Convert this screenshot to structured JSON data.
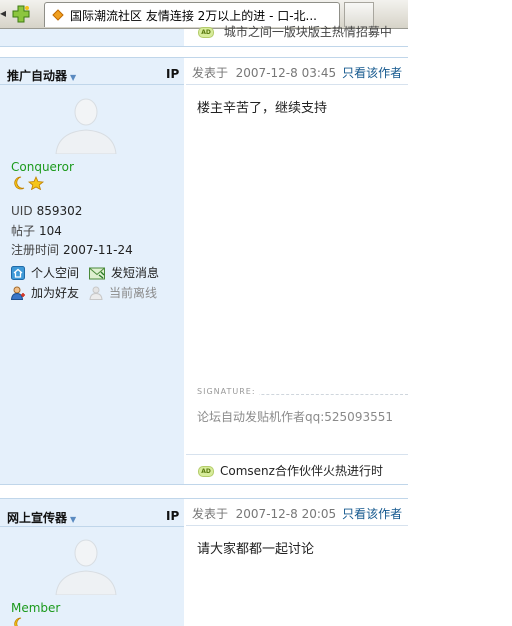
{
  "tab": {
    "title": "国际潮流社区  友情连接  2万以上的进  -  口-北..."
  },
  "top_strip": {
    "ad_text": "城市之间一版块版主热情招募中"
  },
  "posts": [
    {
      "author": "推广自动器",
      "ip_label": "IP",
      "rank": "Conqueror",
      "stats": [
        {
          "key": "UID",
          "value": "859302"
        },
        {
          "key": "帖子",
          "value": "104"
        },
        {
          "key": "注册时间",
          "value": "2007-11-24"
        }
      ],
      "actions": {
        "personal_space": "个人空间",
        "send_message": "发短消息",
        "add_friend": "加为好友",
        "status": "当前离线"
      },
      "posted_prefix": "发表于",
      "posted_time": "2007-12-8 03:45",
      "only_author": "只看该作者",
      "content": "楼主辛苦了，继续支持",
      "signature_label": "SIGNATURE:",
      "signature": "论坛自动发贴机作者qq:525093551",
      "ad_text": "Comsenz合作伙伴火热进行时"
    },
    {
      "author": "网上宣传器",
      "ip_label": "IP",
      "rank": "Member",
      "posted_prefix": "发表于",
      "posted_time": "2007-12-8 20:05",
      "only_author": "只看该作者",
      "content": "请大家都都一起讨论"
    }
  ],
  "colors": {
    "left_panel": "#e5f0fb",
    "rank_green": "#1c9a1c",
    "link_blue": "#14588e",
    "border_blue": "#c0d6ea"
  }
}
